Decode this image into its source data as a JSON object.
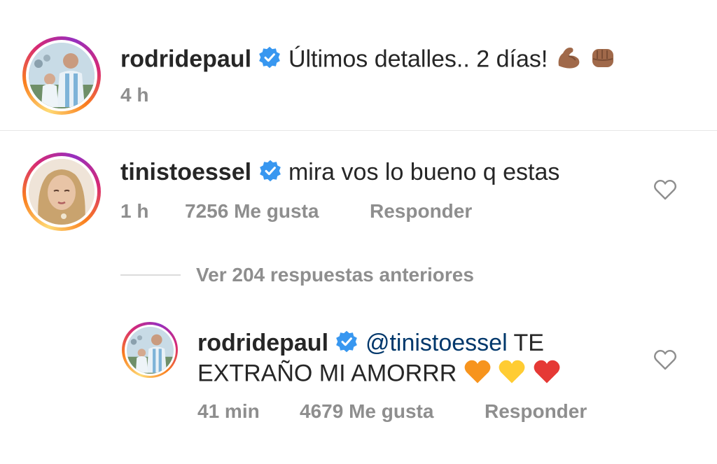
{
  "post": {
    "username": "rodridepaul",
    "caption": "Últimos detalles.. 2 días!",
    "time": "4 h"
  },
  "comment": {
    "username": "tinistoessel",
    "text": "mira vos lo bueno q estas",
    "time": "1 h",
    "likes": "7256 Me gusta",
    "reply_label": "Responder"
  },
  "view_replies": "Ver 204 respuestas anteriores",
  "reply": {
    "username": "rodridepaul",
    "mention": "@tinistoessel",
    "text_part1": "TE",
    "text_part2": "EXTRAÑO MI AMORRR",
    "time": "41 min",
    "likes": "4679 Me gusta",
    "reply_label": "Responder"
  },
  "colors": {
    "verified": "#3897f0",
    "meta_gray": "#8e8e8e",
    "mention_blue": "#00376b"
  }
}
